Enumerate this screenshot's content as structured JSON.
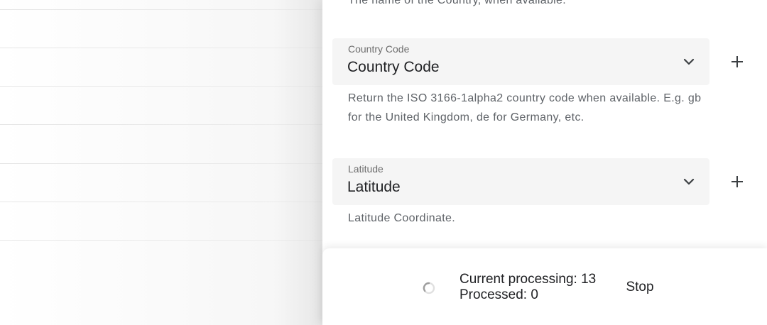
{
  "previous_field": {
    "description_clipped": "The name of the Country, when available."
  },
  "fields": [
    {
      "label": "Country Code",
      "value": "Country Code",
      "description": "Return the ISO 3166-1alpha2 country code when available. E.g. gb for the United Kingdom, de for Germany, etc.",
      "dropdown_icon": "chevron-down-icon",
      "add_icon": "plus-icon"
    },
    {
      "label": "Latitude",
      "value": "Latitude",
      "description": "Latitude Coordinate.",
      "dropdown_icon": "chevron-down-icon",
      "add_icon": "plus-icon"
    }
  ],
  "status": {
    "current_processing": "Current processing: 13",
    "processed": "Processed: 0",
    "stop_label": "Stop",
    "spinner_icon": "loading-spinner-icon"
  },
  "colors": {
    "field_bg": "#f5f5f5",
    "text_primary": "#202124",
    "text_secondary": "#5f6368"
  }
}
